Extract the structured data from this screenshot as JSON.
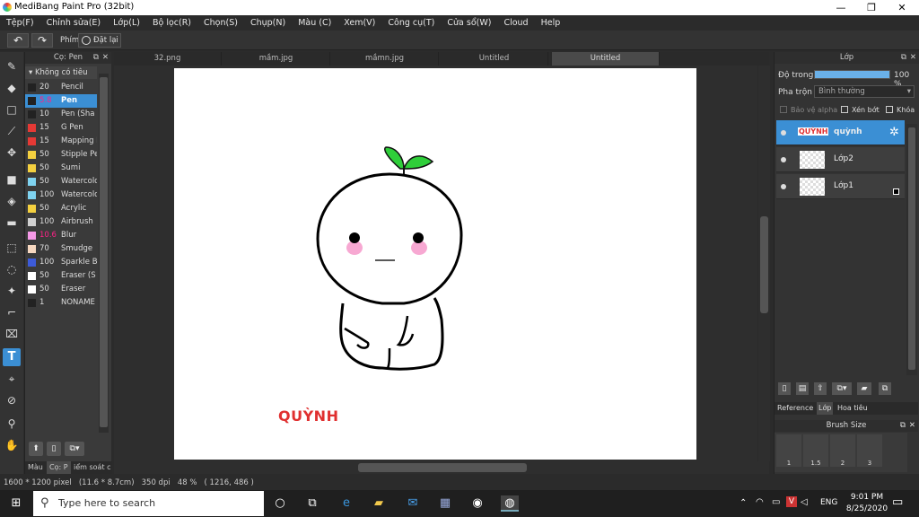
{
  "window": {
    "title": "MediBang Paint Pro (32bit)",
    "minimize": "—",
    "maximize": "❐",
    "close": "✕"
  },
  "menu": [
    "Tệp(F)",
    "Chỉnh sửa(E)",
    "Lớp(L)",
    "Bộ lọc(R)",
    "Chọn(S)",
    "Chụp(N)",
    "Màu (C)",
    "Xem(V)",
    "Công cụ(T)",
    "Cửa sổ(W)",
    "Cloud",
    "Help"
  ],
  "toolbar": {
    "undo": "↶",
    "redo": "↷",
    "shortcut_label": "Phím",
    "reset_label": "Đặt lại"
  },
  "brush_panel": {
    "title": "Cọ: Pen",
    "group": "Không có tiêu",
    "brushes": [
      {
        "size": "20",
        "name": "Pencil",
        "color": "#222222"
      },
      {
        "size": "5.8",
        "name": "Pen",
        "color": "#222222"
      },
      {
        "size": "10",
        "name": "Pen (Sha",
        "color": "#222222"
      },
      {
        "size": "15",
        "name": "G Pen",
        "color": "#e53935"
      },
      {
        "size": "15",
        "name": "Mapping I",
        "color": "#e53935"
      },
      {
        "size": "50",
        "name": "Stipple Pe",
        "color": "#f4d03f"
      },
      {
        "size": "50",
        "name": "Sumi",
        "color": "#f4d03f"
      },
      {
        "size": "50",
        "name": "Watercolo",
        "color": "#7fd3f0"
      },
      {
        "size": "100",
        "name": "Watercolo",
        "color": "#7fd3f0"
      },
      {
        "size": "50",
        "name": "Acrylic",
        "color": "#f4d03f"
      },
      {
        "size": "100",
        "name": "Airbrush",
        "color": "#cfcfcf"
      },
      {
        "size": "10.6",
        "name": "Blur",
        "color": "#f59ae8"
      },
      {
        "size": "70",
        "name": "Smudge",
        "color": "#f7d8c0"
      },
      {
        "size": "100",
        "name": "Sparkle B",
        "color": "#3d5bd9"
      },
      {
        "size": "50",
        "name": "Eraser (S",
        "color": "#ffffff"
      },
      {
        "size": "50",
        "name": "Eraser",
        "color": "#ffffff"
      },
      {
        "size": "1",
        "name": "NONAME",
        "color": "#222222"
      }
    ],
    "bottom_tabs": [
      "Màu",
      "Cọ: P",
      "iểm soát c"
    ]
  },
  "doc_tabs": [
    "32.png",
    "mầm.jpg",
    "mầmn.jpg",
    "Untitled",
    "Untitled"
  ],
  "canvas": {
    "signature": "QUỲNH"
  },
  "status": {
    "info": "1600 * 1200 pixel   (11.6 * 8.7cm)   350 dpi   48 %   ( 1216, 486 )"
  },
  "layer_panel": {
    "title": "Lớp",
    "opacity_label": "Độ trong",
    "opacity_value": "100 %",
    "opacity": 1.0,
    "blend_label": "Pha trộn",
    "blend_value": "Bình thường",
    "protect_alpha": "Bảo vệ alpha",
    "clipping": "Xén bớt",
    "lock": "Khóa",
    "layers": [
      {
        "name": "quỳnh"
      },
      {
        "name": "Lớp2"
      },
      {
        "name": "Lớp1"
      }
    ],
    "bottom_tabs": [
      "Reference",
      "Lớp",
      "Hoa tiêu"
    ]
  },
  "brush_size_panel": {
    "title": "Brush Size",
    "sizes": [
      "1",
      "1.5",
      "2",
      "3"
    ]
  },
  "taskbar": {
    "search_placeholder": "Type here to search",
    "time": "9:01 PM",
    "date": "8/25/2020",
    "lang": "ENG"
  }
}
